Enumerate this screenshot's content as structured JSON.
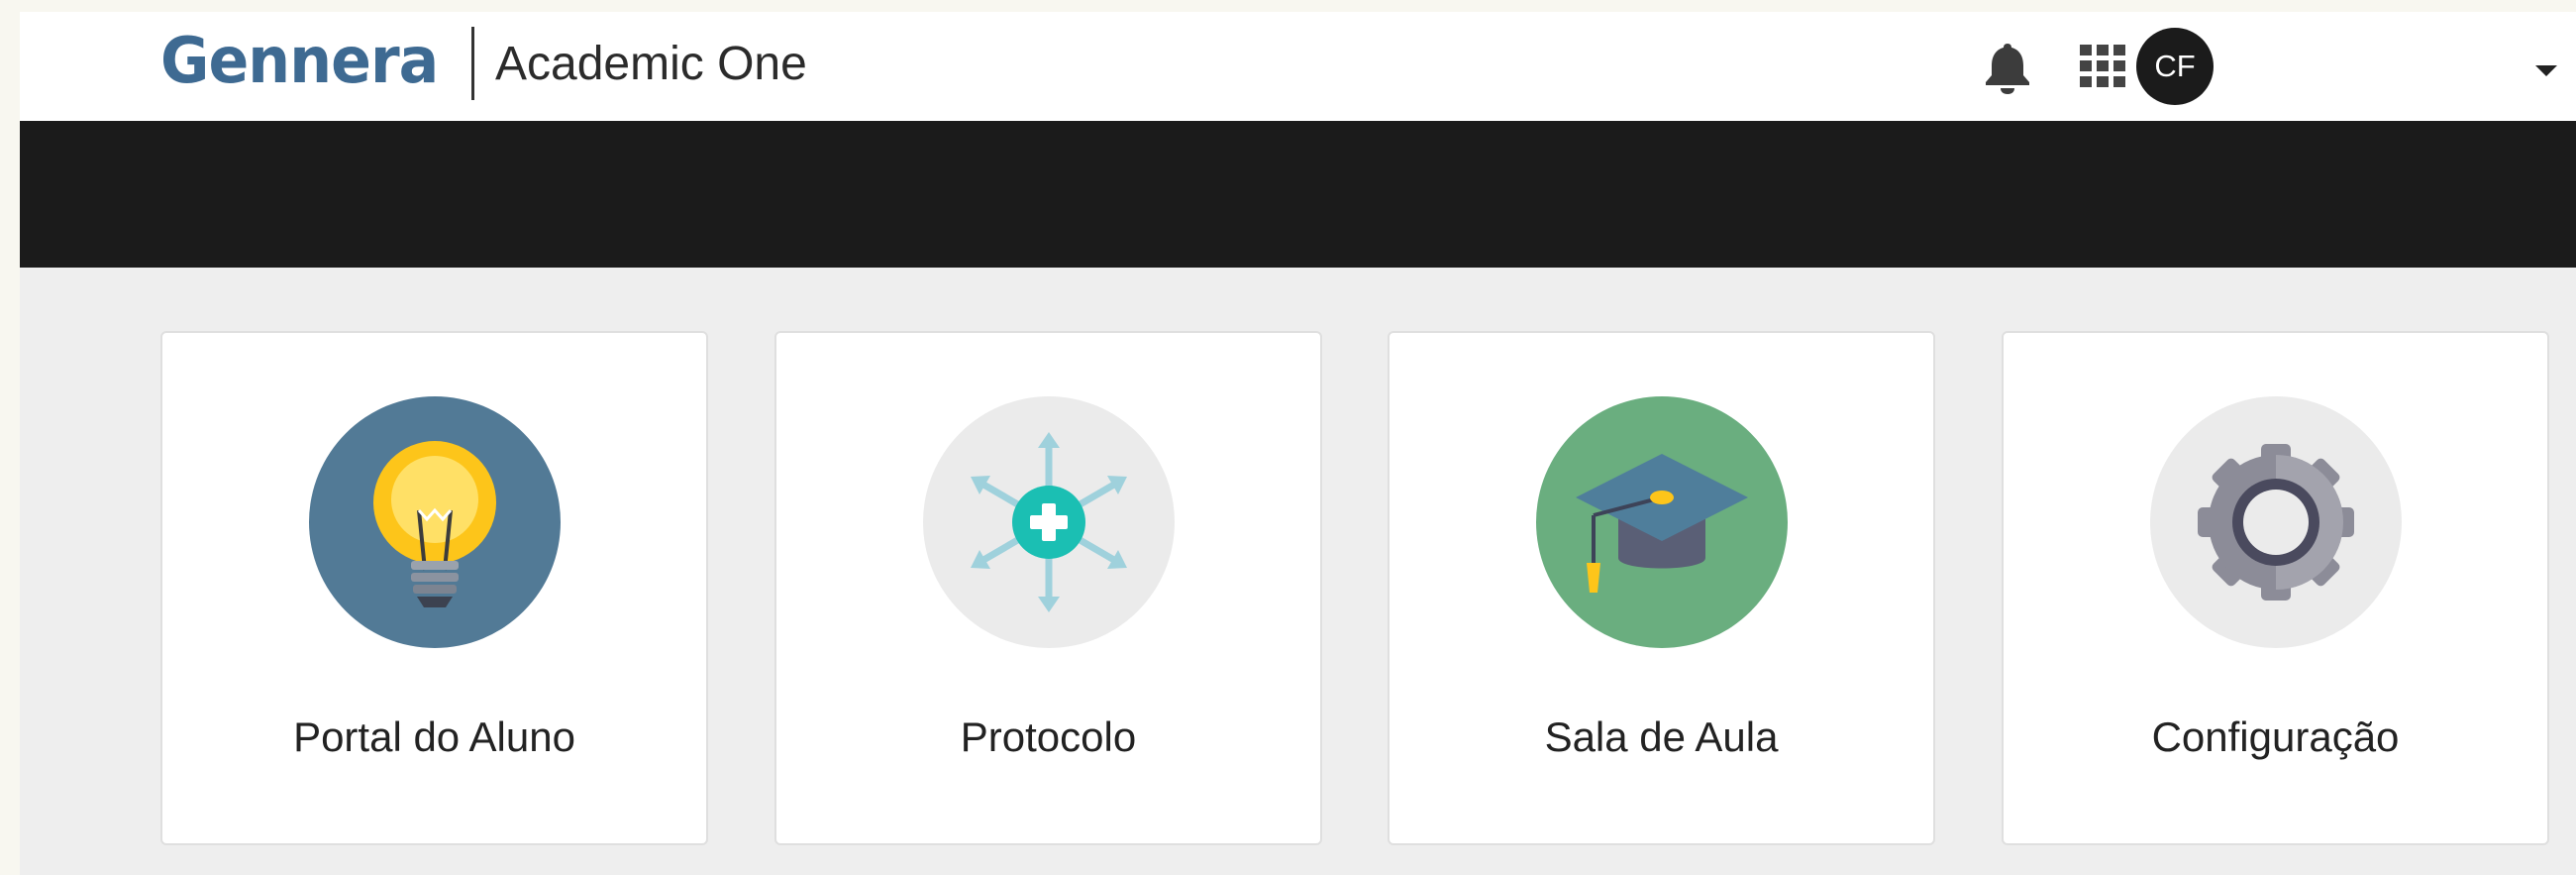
{
  "header": {
    "brand": "Gennera",
    "app_name": "Academic One",
    "notifications_icon": "bell-icon",
    "apps_icon": "grid-icon",
    "user_initials": "CF",
    "menu_icon": "caret-down-icon"
  },
  "colors": {
    "brand_blue": "#3e6a92",
    "banner": "#1b1b1b",
    "page_background": "#eeeeee",
    "portal_circle": "#527a96",
    "protocolo_circle": "#ebebeb",
    "sala_circle": "#6aae7f",
    "config_circle": "#ebebeb"
  },
  "modules": [
    {
      "label": "Portal do Aluno",
      "icon": "lightbulb-icon"
    },
    {
      "label": "Protocolo",
      "icon": "medical-arrows-icon"
    },
    {
      "label": "Sala de Aula",
      "icon": "graduation-cap-icon"
    },
    {
      "label": "Configuração",
      "icon": "gear-icon"
    }
  ]
}
